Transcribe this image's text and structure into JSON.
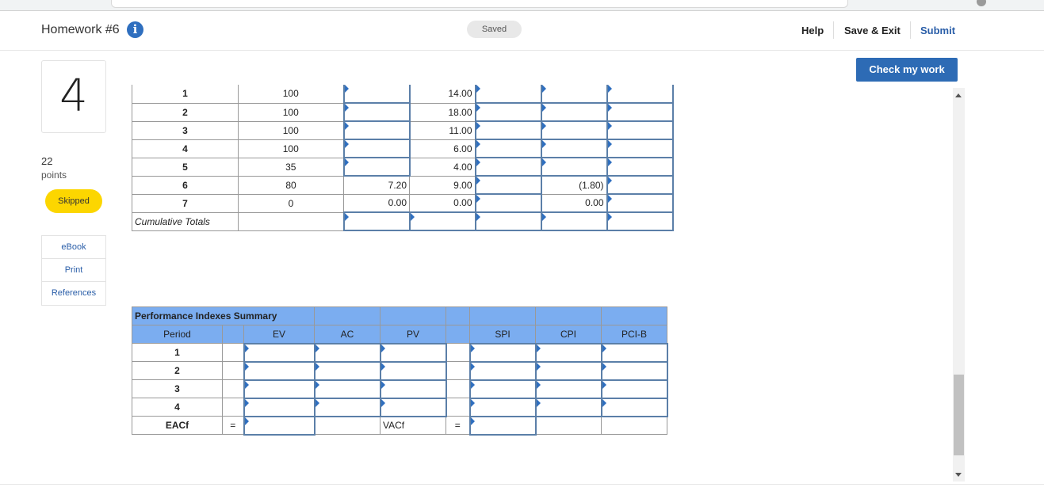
{
  "header": {
    "title": "Homework #6",
    "saved": "Saved",
    "help": "Help",
    "save_exit": "Save & Exit",
    "submit": "Submit"
  },
  "check_button": "Check my work",
  "question": {
    "number": "4",
    "points": "22",
    "points_label": "points",
    "status": "Skipped"
  },
  "side_menu": [
    "eBook",
    "Print",
    "References"
  ],
  "upper_table": {
    "rows": [
      {
        "period": "1",
        "val": "100",
        "c3": "",
        "c4": "14.00",
        "c6": ""
      },
      {
        "period": "2",
        "val": "100",
        "c3": "",
        "c4": "18.00",
        "c6": ""
      },
      {
        "period": "3",
        "val": "100",
        "c3": "",
        "c4": "11.00",
        "c6": ""
      },
      {
        "period": "4",
        "val": "100",
        "c3": "",
        "c4": "6.00",
        "c6": ""
      },
      {
        "period": "5",
        "val": "35",
        "c3": "",
        "c4": "4.00",
        "c6": ""
      },
      {
        "period": "6",
        "val": "80",
        "c3": "7.20",
        "c4": "9.00",
        "c6": "(1.80)"
      },
      {
        "period": "7",
        "val": "0",
        "c3": "0.00",
        "c4": "0.00",
        "c6": "0.00"
      }
    ],
    "totals_label": "Cumulative Totals"
  },
  "summary_table": {
    "title": "Performance Indexes Summary",
    "headers": {
      "period": "Period",
      "ev": "EV",
      "ac": "AC",
      "pv": "PV",
      "spi": "SPI",
      "cpi": "CPI",
      "pcib": "PCI-B"
    },
    "periods": [
      "1",
      "2",
      "3",
      "4"
    ],
    "eacf_label": "EACf",
    "vacf_label": "VACf",
    "equals": "="
  }
}
